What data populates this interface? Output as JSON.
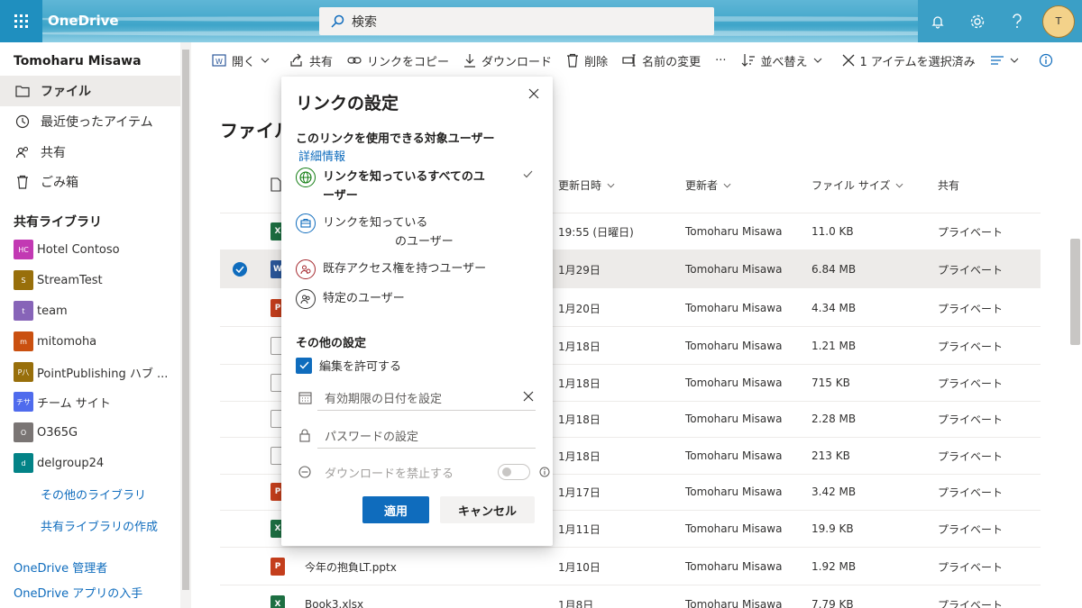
{
  "app": {
    "title": "OneDrive",
    "search_placeholder": "検索",
    "avatar_initial": "T"
  },
  "sidebar": {
    "user": "Tomoharu Misawa",
    "nav": [
      {
        "label": "ファイル",
        "icon": "folder-icon",
        "active": true
      },
      {
        "label": "最近使ったアイテム",
        "icon": "clock-icon"
      },
      {
        "label": "共有",
        "icon": "people-icon"
      },
      {
        "label": "ごみ箱",
        "icon": "trash-icon"
      }
    ],
    "shared_libraries_title": "共有ライブラリ",
    "libraries": [
      {
        "badge": "HC",
        "label": "Hotel Contoso",
        "color": "#c239b3"
      },
      {
        "badge": "S",
        "label": "StreamTest",
        "color": "#986f0b"
      },
      {
        "badge": "t",
        "label": "team",
        "color": "#8764b8"
      },
      {
        "badge": "m",
        "label": "mitomoha",
        "color": "#ca5010"
      },
      {
        "badge": "P八",
        "label": "PointPublishing ハブ ...",
        "color": "#986f0b"
      },
      {
        "badge": "チサ",
        "label": "チーム サイト",
        "color": "#4f6bed"
      },
      {
        "badge": "O",
        "label": "O365G",
        "color": "#7a7574"
      },
      {
        "badge": "d",
        "label": "delgroup24",
        "color": "#038387"
      }
    ],
    "more_libraries": "その他のライブラリ",
    "create_library": "共有ライブラリの作成",
    "admin_link": "OneDrive 管理者",
    "get_app_link": "OneDrive アプリの入手"
  },
  "commands": {
    "open": "開く",
    "share": "共有",
    "copy_link": "リンクをコピー",
    "download": "ダウンロード",
    "delete": "削除",
    "rename": "名前の変更",
    "more": "···",
    "sort": "並べ替え",
    "selected": "1 アイテムを選択済み"
  },
  "main": {
    "title": "ファイル",
    "columns": {
      "modified": "更新日時",
      "modified_by": "更新者",
      "size": "ファイル サイズ",
      "sharing": "共有"
    },
    "rows": [
      {
        "type": "x",
        "name": "",
        "modified": "19:55 (日曜日)",
        "by": "Tomoharu Misawa",
        "size": "11.0 KB",
        "sharing": "プライベート",
        "selected": false
      },
      {
        "type": "w",
        "name": "",
        "modified": "1月29日",
        "by": "Tomoharu Misawa",
        "size": "6.84 MB",
        "sharing": "プライベート",
        "selected": true
      },
      {
        "type": "p",
        "name": "",
        "modified": "1月20日",
        "by": "Tomoharu Misawa",
        "size": "4.34 MB",
        "sharing": "プライベート",
        "selected": false
      },
      {
        "type": "img",
        "name": "",
        "modified": "1月18日",
        "by": "Tomoharu Misawa",
        "size": "1.21 MB",
        "sharing": "プライベート",
        "selected": false
      },
      {
        "type": "img",
        "name": "",
        "modified": "1月18日",
        "by": "Tomoharu Misawa",
        "size": "715 KB",
        "sharing": "プライベート",
        "selected": false
      },
      {
        "type": "img",
        "name": "",
        "modified": "1月18日",
        "by": "Tomoharu Misawa",
        "size": "2.28 MB",
        "sharing": "プライベート",
        "selected": false
      },
      {
        "type": "img",
        "name": "",
        "modified": "1月18日",
        "by": "Tomoharu Misawa",
        "size": "213 KB",
        "sharing": "プライベート",
        "selected": false
      },
      {
        "type": "p",
        "name": "",
        "modified": "1月17日",
        "by": "Tomoharu Misawa",
        "size": "3.42 MB",
        "sharing": "プライベート",
        "selected": false
      },
      {
        "type": "x",
        "name": "",
        "modified": "1月11日",
        "by": "Tomoharu Misawa",
        "size": "19.9 KB",
        "sharing": "プライベート",
        "selected": false
      },
      {
        "type": "p",
        "name": "今年の抱負LT.pptx",
        "modified": "1月10日",
        "by": "Tomoharu Misawa",
        "size": "1.92 MB",
        "sharing": "プライベート",
        "selected": false
      },
      {
        "type": "x",
        "name": "Book3.xlsx",
        "modified": "1月8日",
        "by": "Tomoharu Misawa",
        "size": "7.79 KB",
        "sharing": "プライベート",
        "selected": false
      }
    ]
  },
  "dialog": {
    "title": "リンクの設定",
    "audience_heading": "このリンクを使用できる対象ユーザー",
    "learn_more": "詳細情報",
    "options": [
      {
        "line1": "リンクを知っているすべてのユ",
        "line2": "ーザー",
        "selected": true,
        "color": "#107c10"
      },
      {
        "line1": "リンクを知っている",
        "line2": "のユーザー",
        "selected": false,
        "color": "#0f6cbd"
      },
      {
        "line1": "既存アクセス権を持つユーザー",
        "line2": "",
        "selected": false,
        "color": "#a4262c"
      },
      {
        "line1": "特定のユーザー",
        "line2": "",
        "selected": false,
        "color": "#323130"
      }
    ],
    "other_settings": "その他の設定",
    "allow_edit": "編集を許可する",
    "expiry": "有効期限の日付を設定",
    "password": "パスワードの設定",
    "block_download": "ダウンロードを禁止する",
    "apply": "適用",
    "cancel": "キャンセル"
  }
}
